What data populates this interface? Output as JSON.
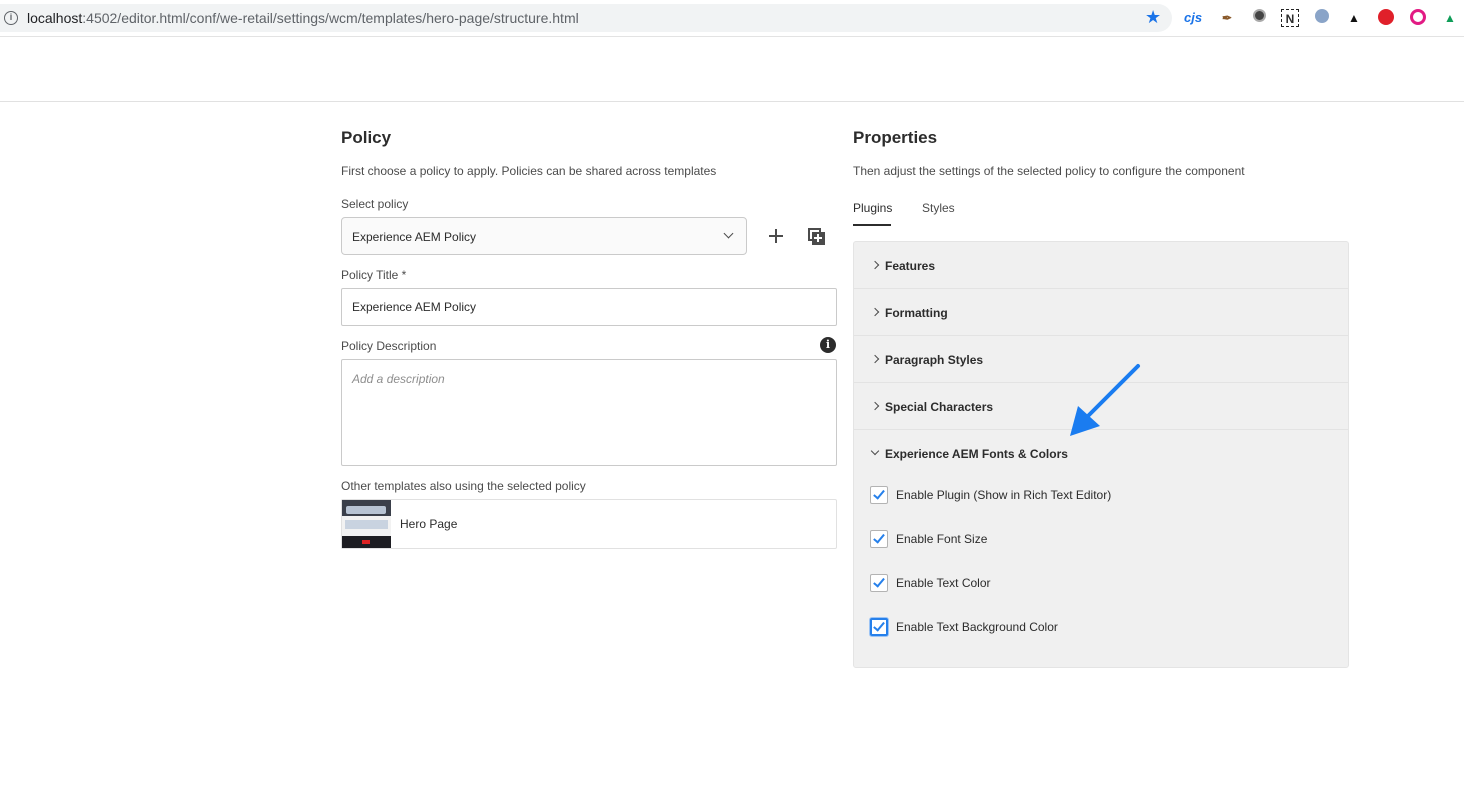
{
  "browser": {
    "url_host": "localhost",
    "url_rest": ":4502/editor.html/conf/we-retail/settings/wcm/templates/hero-page/structure.html",
    "extensions": [
      "cjs-icon",
      "quill-icon",
      "disc-icon",
      "n-icon",
      "moon-icon",
      "spy-icon",
      "stop-hand-icon",
      "eye-icon",
      "gdrive-icon"
    ],
    "extension_labels": {
      "cjs": "cjs",
      "n": "N"
    }
  },
  "policy": {
    "heading": "Policy",
    "subtitle": "First choose a policy to apply. Policies can be shared across templates",
    "select_label": "Select policy",
    "select_value": "Experience AEM Policy",
    "title_label": "Policy Title *",
    "title_value": "Experience AEM Policy",
    "description_label": "Policy Description",
    "description_placeholder": "Add a description",
    "others_label": "Other templates also using the selected policy",
    "template_name": "Hero Page"
  },
  "properties": {
    "heading": "Properties",
    "subtitle": "Then adjust the settings of the selected policy to configure the component",
    "tabs": [
      {
        "label": "Plugins",
        "active": true
      },
      {
        "label": "Styles",
        "active": false
      }
    ],
    "accordion": [
      {
        "title": "Features",
        "open": false
      },
      {
        "title": "Formatting",
        "open": false
      },
      {
        "title": "Paragraph Styles",
        "open": false
      },
      {
        "title": "Special Characters",
        "open": false
      },
      {
        "title": "Experience AEM Fonts & Colors",
        "open": true
      }
    ],
    "checkboxes": [
      {
        "label": "Enable Plugin (Show in Rich Text Editor)",
        "checked": true
      },
      {
        "label": "Enable Font Size",
        "checked": true
      },
      {
        "label": "Enable Text Color",
        "checked": true
      },
      {
        "label": "Enable Text Background Color",
        "checked": true
      }
    ]
  },
  "colors": {
    "accent": "#2680eb",
    "arrow": "#1a7cf0",
    "panel_bg": "#f0f0f0"
  }
}
